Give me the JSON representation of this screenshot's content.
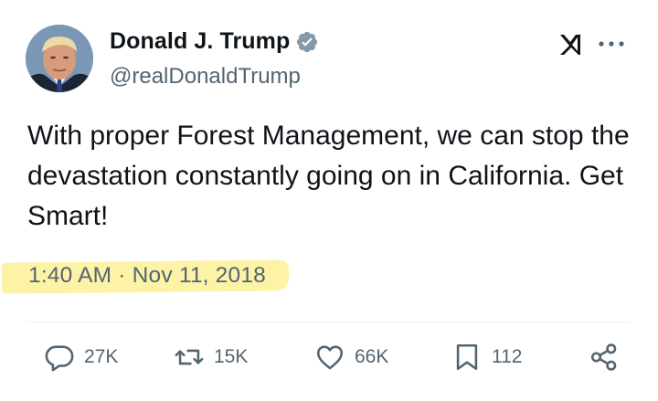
{
  "author": {
    "name": "Donald J. Trump",
    "handle": "@realDonaldTrump",
    "verified": true,
    "verified_color": "#829aab"
  },
  "tweet": {
    "text": "With proper Forest Management, we can stop the devastation constantly going on in California. Get Smart!",
    "timestamp": "1:40 AM · Nov 11, 2018"
  },
  "actions": {
    "reply_count": "27K",
    "retweet_count": "15K",
    "like_count": "66K",
    "bookmark_count": "112"
  },
  "icons": {
    "logo": "grok-icon",
    "more": "more-icon",
    "reply": "reply-icon",
    "retweet": "retweet-icon",
    "like": "heart-icon",
    "bookmark": "bookmark-icon",
    "share": "share-icon"
  },
  "colors": {
    "text": "#0f1419",
    "secondary": "#536471",
    "highlight": "#fdf3a7"
  }
}
